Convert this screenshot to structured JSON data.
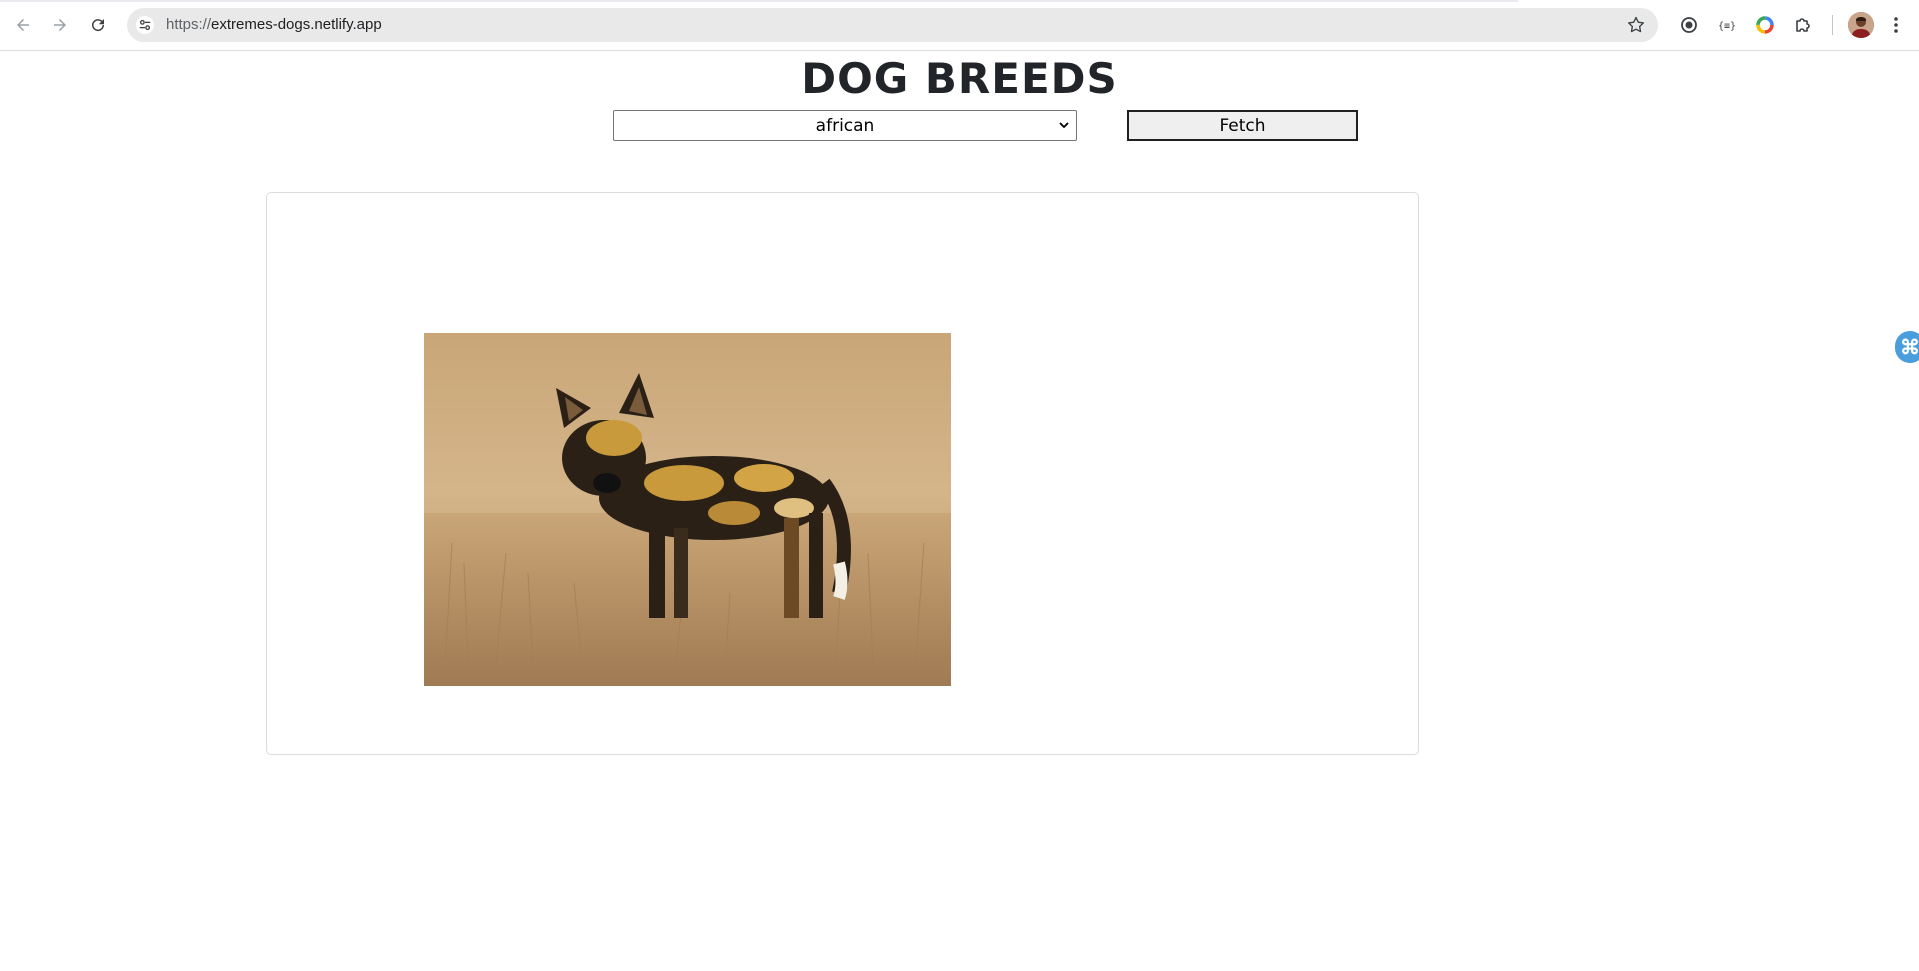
{
  "browser": {
    "url_scheme": "https://",
    "url_host": "extremes-dogs.netlify.app",
    "icons": {
      "back": "back-arrow-icon",
      "forward": "forward-arrow-icon",
      "reload": "reload-icon",
      "site_info": "tune-icon",
      "bookmark": "star-icon",
      "extensions": [
        "record-icon",
        "json-icon",
        "color-wheel-icon",
        "puzzle-icon"
      ],
      "menu": "kebab-menu-icon"
    }
  },
  "page": {
    "title": "DOG BREEDS",
    "breed_select": {
      "selected": "african"
    },
    "fetch_label": "Fetch",
    "image": {
      "alt": "african",
      "subject": "african wild dog standing in dry grass"
    }
  },
  "side_widget": {
    "glyph": "⌘"
  }
}
